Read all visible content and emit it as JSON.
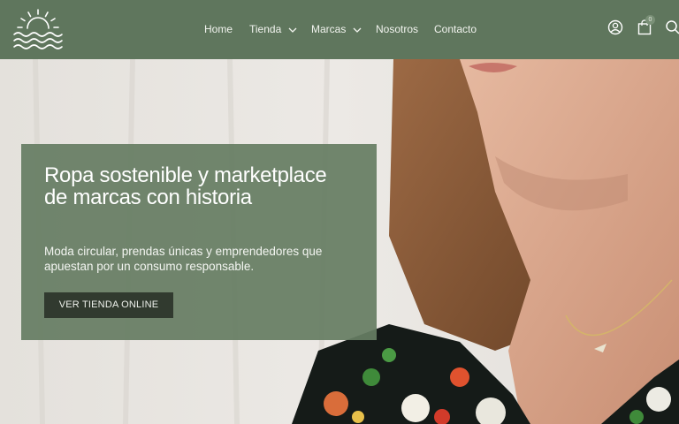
{
  "nav": {
    "items": [
      {
        "label": "Home",
        "has_dropdown": false
      },
      {
        "label": "Tienda",
        "has_dropdown": true
      },
      {
        "label": "Marcas",
        "has_dropdown": true
      },
      {
        "label": "Nosotros",
        "has_dropdown": false
      },
      {
        "label": "Contacto",
        "has_dropdown": false
      }
    ]
  },
  "header": {
    "logo_icon": "sun-over-waves-icon",
    "account_icon": "user-icon",
    "cart_icon": "shopping-bag-icon",
    "cart_count": "0",
    "search_icon": "search-icon"
  },
  "hero": {
    "title": "Ropa sostenible y marketplace de marcas con historia",
    "subtitle": "Moda circular, prendas únicas y emprendedores que apuestan por un consumo responsable.",
    "cta_label": "VER TIENDA ONLINE"
  },
  "colors": {
    "header_bg": "#5f765d",
    "promo_bg": "#667d63",
    "cta_bg": "#313a2f"
  }
}
